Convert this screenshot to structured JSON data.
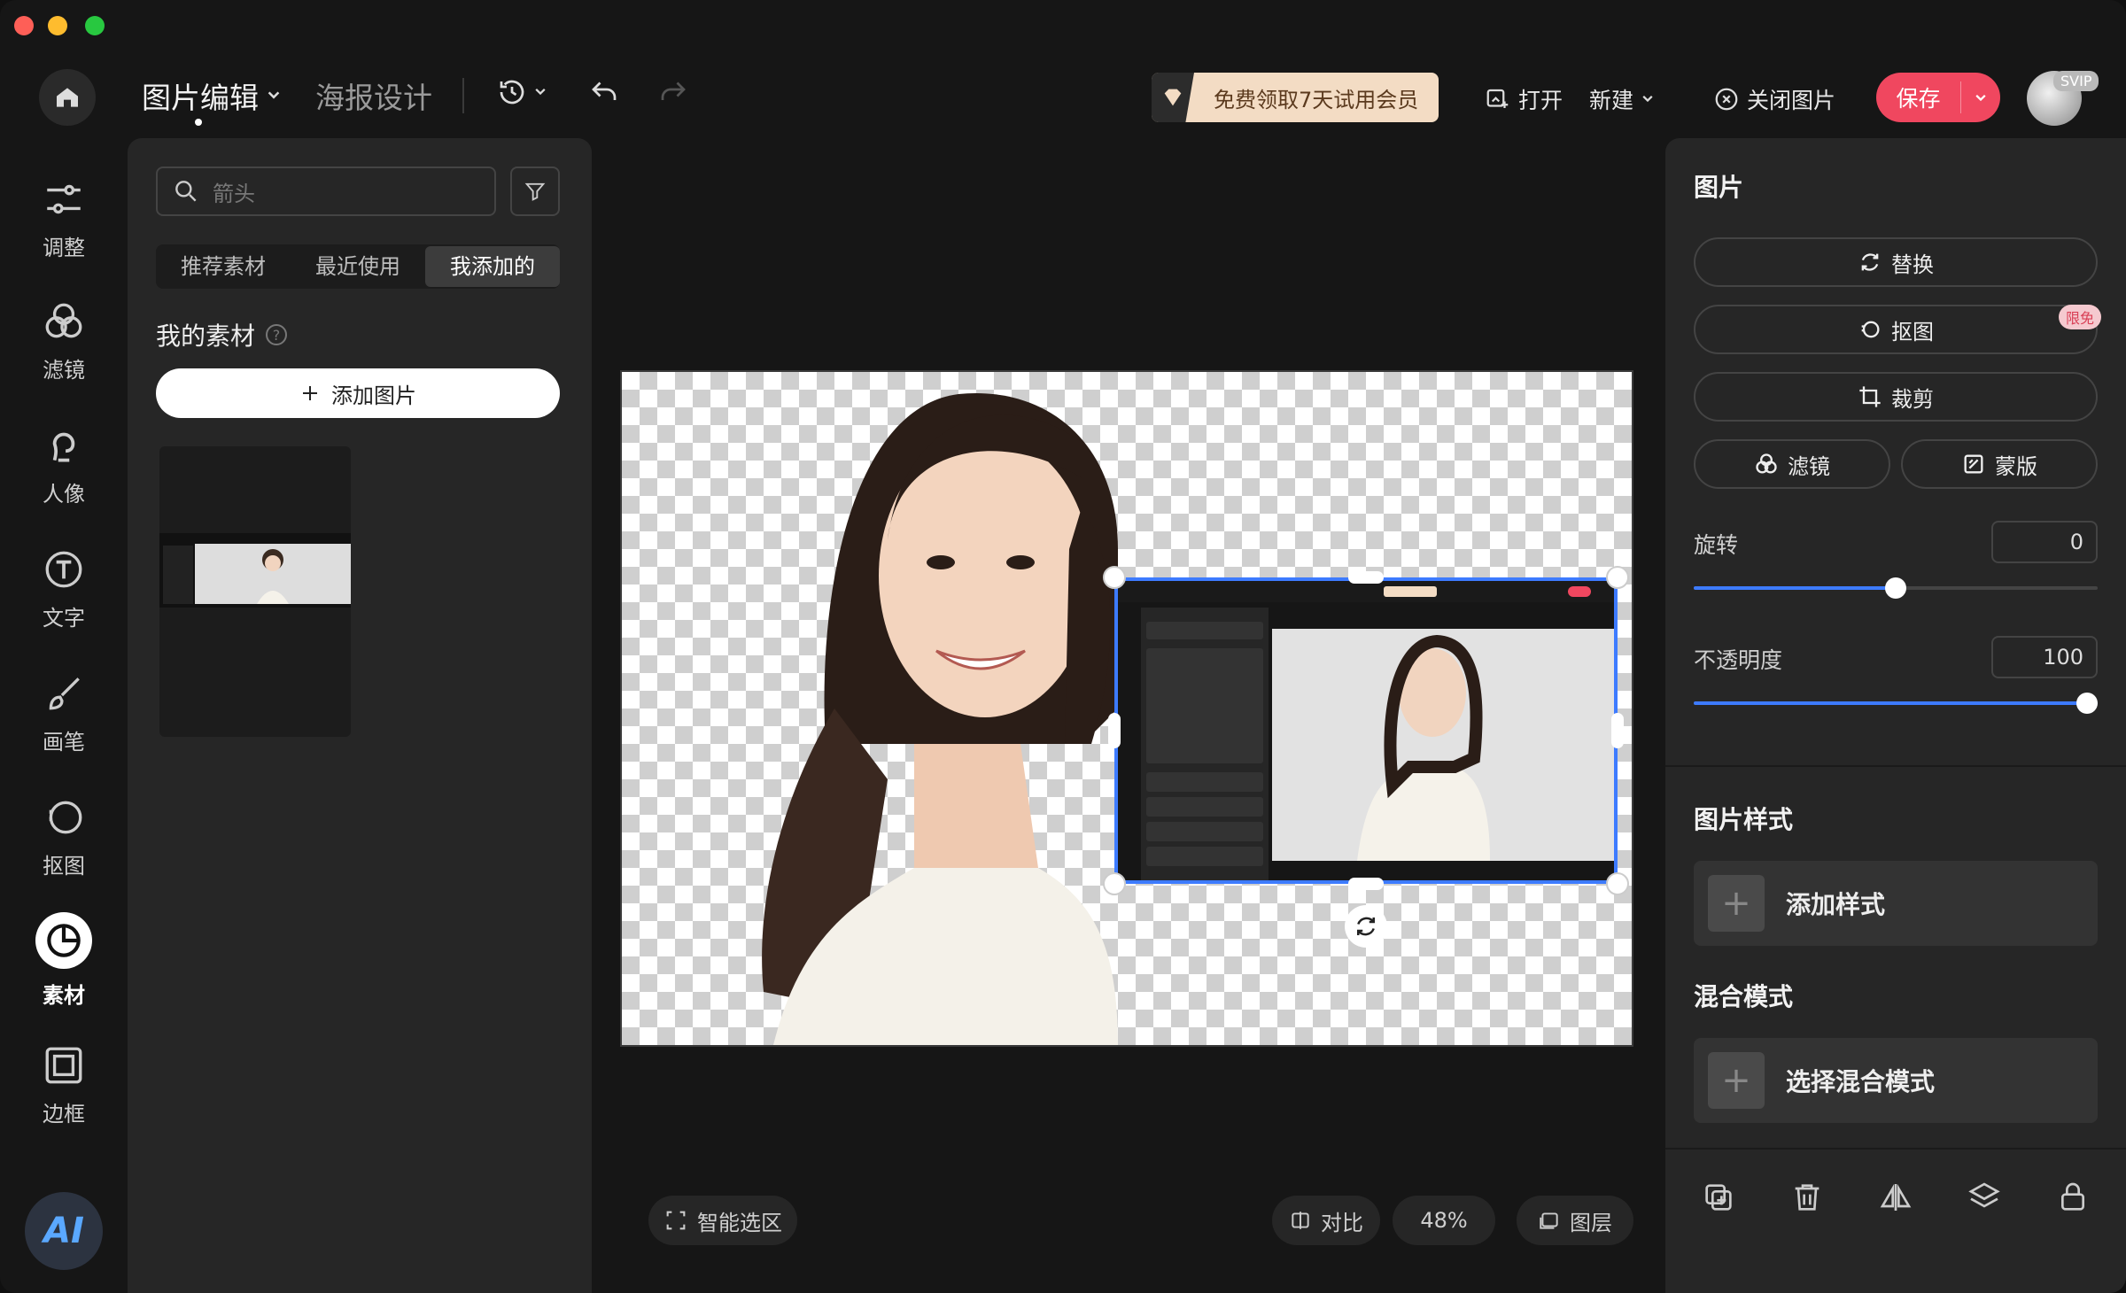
{
  "colors": {
    "accent": "#3d7bff",
    "save": "#f0475f",
    "promo_bg": "#f3dcc4"
  },
  "header": {
    "tab_edit": "图片编辑",
    "tab_poster": "海报设计",
    "promo": "免费领取7天试用会员",
    "open": "打开",
    "new": "新建",
    "close_image": "关闭图片",
    "save": "保存",
    "svip": "SVIP"
  },
  "nav": [
    {
      "label": "调整",
      "icon": "sliders-icon"
    },
    {
      "label": "滤镜",
      "icon": "filter-icon"
    },
    {
      "label": "人像",
      "icon": "portrait-icon"
    },
    {
      "label": "文字",
      "icon": "text-icon"
    },
    {
      "label": "画笔",
      "icon": "brush-icon"
    },
    {
      "label": "抠图",
      "icon": "cutout-icon"
    },
    {
      "label": "素材",
      "icon": "material-icon"
    },
    {
      "label": "边框",
      "icon": "frame-icon"
    }
  ],
  "ai_label": "AI",
  "assets": {
    "search_placeholder": "箭头",
    "tabs": [
      "推荐素材",
      "最近使用",
      "我添加的"
    ],
    "section_title": "我的素材",
    "add_image": "添加图片"
  },
  "canvas_bottom": {
    "smart_select": "智能选区",
    "compare": "对比",
    "zoom": "48%",
    "layers": "图层"
  },
  "right": {
    "section_image": "图片",
    "replace": "替换",
    "cutout": "抠图",
    "cutout_badge": "限免",
    "crop": "裁剪",
    "filter": "滤镜",
    "mask": "蒙版",
    "rotate_label": "旋转",
    "rotate_value": "0",
    "opacity_label": "不透明度",
    "opacity_value": "100",
    "style_title": "图片样式",
    "add_style": "添加样式",
    "blend_title": "混合模式",
    "choose_blend": "选择混合模式"
  }
}
